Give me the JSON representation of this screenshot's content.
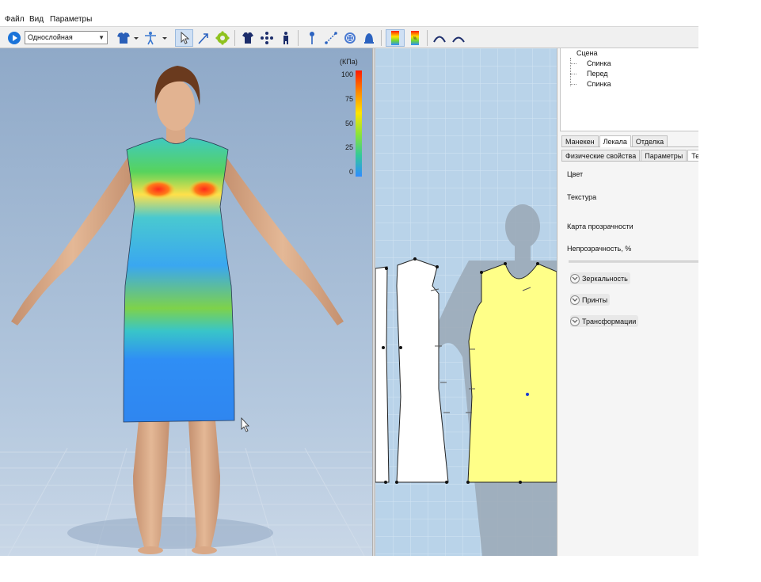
{
  "menu": {
    "items": [
      "Файл",
      "Вид",
      "Параметры"
    ]
  },
  "toolbar": {
    "mode_select": {
      "value": "Однослойная"
    },
    "icons": [
      "play-icon",
      "shirt-icon",
      "mannequin-icon",
      "select-arrow-icon",
      "draw-arrow-icon",
      "gear-icon",
      "garment-icon",
      "points-icon",
      "mannequin-small-icon",
      "pin-icon",
      "measure-icon",
      "button-icon",
      "bell-icon",
      "pressure-map-icon",
      "fit-map-icon",
      "curve-up-icon",
      "curve-down-icon"
    ]
  },
  "legend": {
    "unit": "(КПа)",
    "ticks": [
      "100",
      "75",
      "50",
      "25",
      "0"
    ],
    "gradient": [
      "#ff1a00",
      "#ff8800",
      "#ffe400",
      "#8be33a",
      "#33c99a",
      "#2f8cff"
    ]
  },
  "scene_tree": {
    "root": "Сцена",
    "children": [
      "Спинка",
      "Перед",
      "Спинка"
    ]
  },
  "tabs_main": [
    "Манекен",
    "Лекала",
    "Отделка"
  ],
  "tabs_main_active": "Лекала",
  "tabs_sub": [
    "Физические свойства",
    "Параметры",
    "Те"
  ],
  "tabs_sub_active": "Те",
  "properties": {
    "color": "Цвет",
    "texture": "Текстура",
    "transparency_map": "Карта прозрачности",
    "opacity": "Непрозрачность, %"
  },
  "sections": [
    "Зеркальность",
    "Принты",
    "Трансформации"
  ],
  "colors": {
    "viewport_bg": "#a9c1dc",
    "pattern_white": "#ffffff",
    "pattern_yellow": "#ffff88",
    "grid_bg": "#b9d3e9"
  }
}
